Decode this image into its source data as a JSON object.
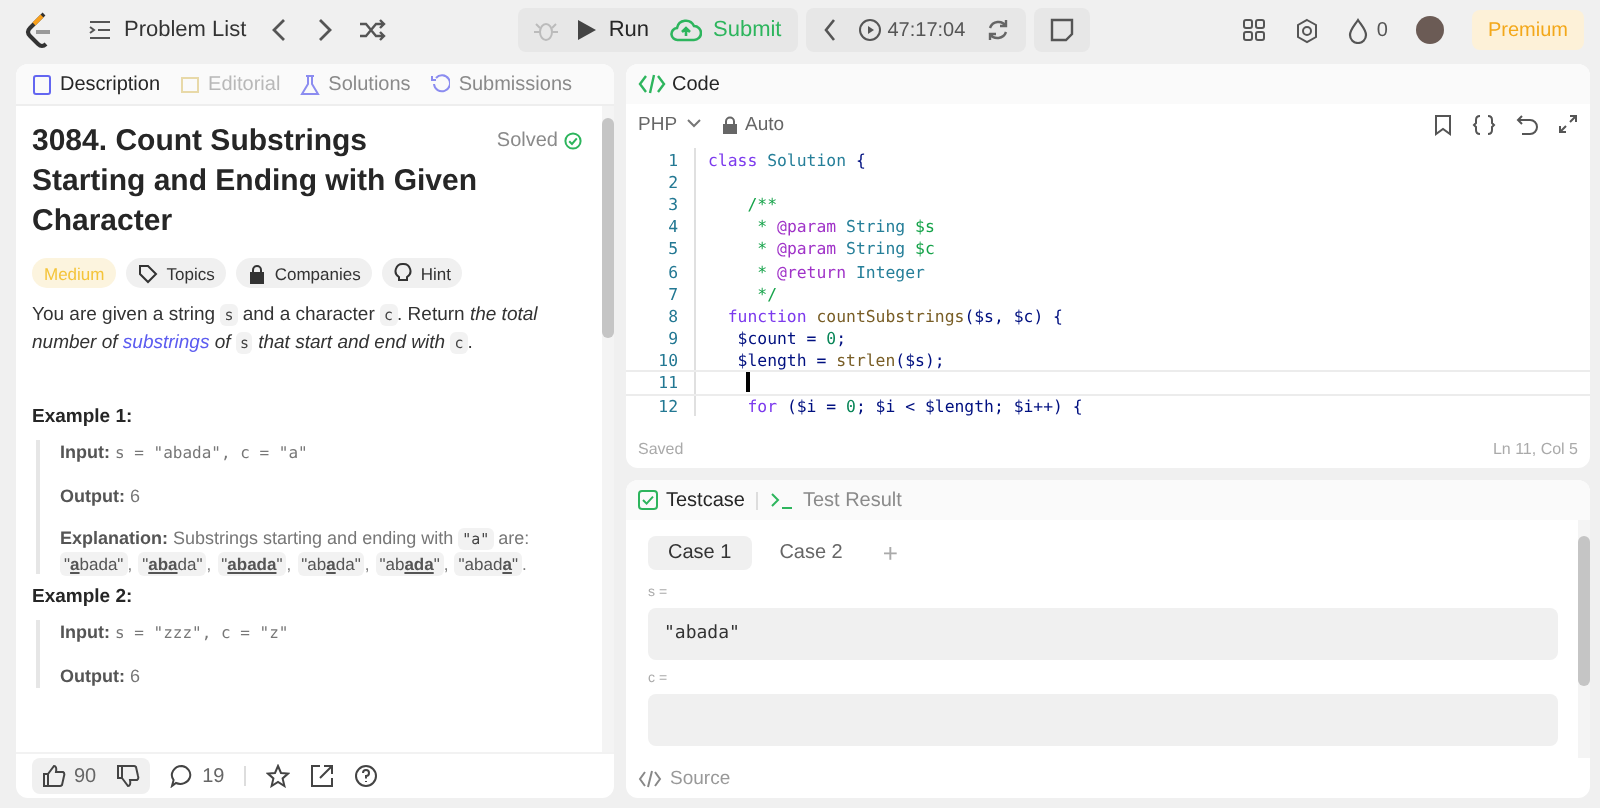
{
  "topbar": {
    "problem_list": "Problem List",
    "run": "Run",
    "submit": "Submit",
    "timer": "47:17:04",
    "streak": "0",
    "premium": "Premium"
  },
  "left": {
    "tabs": [
      {
        "label": "Description",
        "selected": true,
        "disabled": false
      },
      {
        "label": "Editorial",
        "selected": false,
        "disabled": true
      },
      {
        "label": "Solutions",
        "selected": false,
        "disabled": false
      },
      {
        "label": "Submissions",
        "selected": false,
        "disabled": false
      }
    ],
    "title": "3084. Count Substrings Starting and Ending with Given Character",
    "status": "Solved",
    "tags": [
      {
        "label": "Medium",
        "kind": "difficulty"
      },
      {
        "label": "Topics",
        "kind": "tag"
      },
      {
        "label": "Companies",
        "kind": "lock"
      },
      {
        "label": "Hint",
        "kind": "bulb"
      }
    ],
    "description": [
      {
        "kind": "text",
        "t": "You are given a string "
      },
      {
        "kind": "code",
        "t": "s"
      },
      {
        "kind": "text",
        "t": " and a character "
      },
      {
        "kind": "code",
        "t": "c"
      },
      {
        "kind": "text",
        "t": ". Return "
      },
      {
        "kind": "italic",
        "t": "the total number of "
      },
      {
        "kind": "link",
        "t": "substrings"
      },
      {
        "kind": "italic",
        "t": " of "
      },
      {
        "kind": "code",
        "t": "s"
      },
      {
        "kind": "italic",
        "t": " that start and end with "
      },
      {
        "kind": "code",
        "t": "c"
      },
      {
        "kind": "text",
        "t": "."
      }
    ],
    "examples": [
      {
        "heading": "Example 1:",
        "input_label": "Input:",
        "input": "s = \"abada\", c = \"a\"",
        "output_label": "Output:",
        "output": "6",
        "explanation_label": "Explanation:",
        "explanation": "Substrings starting and ending with",
        "explanation_code": "\"a\"",
        "explanation_end": "are:",
        "substrings": [
          {
            "t": "\"**a**bada\"",
            "sep": ","
          },
          {
            "t": "\"**aba**da\"",
            "sep": ","
          },
          {
            "t": "\"**abada**\"",
            "sep": ","
          },
          {
            "t": "\"ab**a**da\"",
            "sep": ","
          },
          {
            "t": "\"ab**ada**\"",
            "sep": ","
          },
          {
            "t": "\"abad**a**\"",
            "sep": "."
          }
        ]
      },
      {
        "heading": "Example 2:",
        "input_label": "Input:",
        "input": "s = \"zzz\", c = \"z\"",
        "output_label": "Output:",
        "output": "6"
      }
    ],
    "footer": {
      "likes": "90",
      "comments": "19"
    }
  },
  "code": {
    "title": "Code",
    "language": "PHP",
    "mode": "Auto",
    "lines": [
      {
        "n": "1",
        "current": false,
        "tokens": [
          {
            "kind": "kw",
            "t": "class "
          },
          {
            "kind": "cls",
            "t": "Solution"
          },
          {
            "kind": "p",
            "t": " {"
          }
        ]
      },
      {
        "n": "2",
        "current": false
      },
      {
        "n": "3",
        "current": false,
        "tokens": [
          {
            "kind": "cmt",
            "t": "    /**"
          }
        ]
      },
      {
        "n": "4",
        "current": false,
        "tokens": [
          {
            "kind": "cmt",
            "t": "     * "
          },
          {
            "kind": "tag",
            "t": "@param"
          },
          {
            "kind": "cls",
            "t": " String "
          },
          {
            "kind": "cmt",
            "t": "$s"
          }
        ]
      },
      {
        "n": "5",
        "current": false,
        "tokens": [
          {
            "kind": "cmt",
            "t": "     * "
          },
          {
            "kind": "tag",
            "t": "@param"
          },
          {
            "kind": "cls",
            "t": " String "
          },
          {
            "kind": "cmt",
            "t": "$c"
          }
        ]
      },
      {
        "n": "6",
        "current": false,
        "tokens": [
          {
            "kind": "cmt",
            "t": "     * "
          },
          {
            "kind": "tag",
            "t": "@return"
          },
          {
            "kind": "cls",
            "t": " Integer"
          }
        ]
      },
      {
        "n": "7",
        "current": false,
        "tokens": [
          {
            "kind": "cmt",
            "t": "     */"
          }
        ]
      },
      {
        "n": "8",
        "current": false,
        "tokens": [
          {
            "kind": "kw",
            "t": "  function "
          },
          {
            "kind": "fn",
            "t": "countSubstrings"
          },
          {
            "kind": "p",
            "t": "($s, $c) {"
          }
        ]
      },
      {
        "n": "9",
        "current": false,
        "tokens": [
          {
            "kind": "p",
            "t": "   $count = "
          },
          {
            "kind": "num",
            "t": "0"
          },
          {
            "kind": "p",
            "t": ";"
          }
        ]
      },
      {
        "n": "10",
        "current": false,
        "tokens": [
          {
            "kind": "p",
            "t": "   $length = "
          },
          {
            "kind": "fn",
            "t": "strlen"
          },
          {
            "kind": "p",
            "t": "($s);"
          }
        ]
      },
      {
        "n": "11",
        "current": true
      },
      {
        "n": "12",
        "current": false,
        "tokens": [
          {
            "kind": "kw",
            "t": "    for "
          },
          {
            "kind": "p",
            "t": "($i = "
          },
          {
            "kind": "num",
            "t": "0"
          },
          {
            "kind": "p",
            "t": "; $i < $length; $i++) {"
          }
        ]
      }
    ],
    "saved": "Saved",
    "position": "Ln 11, Col 5"
  },
  "tests": {
    "tabs": [
      {
        "label": "Testcase",
        "selected": true
      },
      {
        "label": "Test Result",
        "selected": false
      }
    ],
    "cases": [
      {
        "label": "Case 1",
        "selected": true
      },
      {
        "label": "Case 2",
        "selected": false
      }
    ],
    "add": "+",
    "params": [
      {
        "name": "s =",
        "value": "\"abada\""
      },
      {
        "name": "c ="
      }
    ],
    "source": "Source"
  }
}
